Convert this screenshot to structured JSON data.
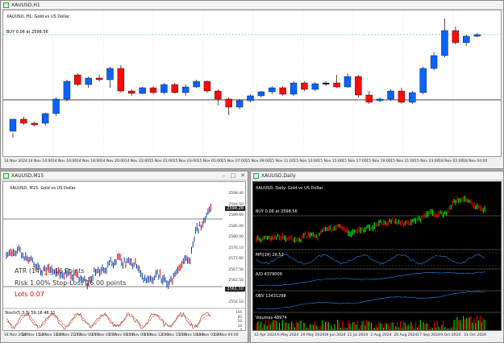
{
  "window_h1": {
    "title": "XAUUSD,H1",
    "chart_label": "XAUUSD, H1: Gold vs US Dollar",
    "order_label": "BUY 0.06 at 2598.56",
    "time_axis": [
      "14 Nov 2024",
      "14 Nov 14:00",
      "14 Nov 16:00",
      "14 Nov 18:00",
      "14 Nov 20:00",
      "14 Nov 22:00",
      "15 Nov 01:00",
      "15 Nov 03:00",
      "15 Nov 05:00",
      "15 Nov 07:00",
      "15 Nov 09:00",
      "15 Nov 11:00",
      "15 Nov 13:00",
      "15 Nov 15:00",
      "15 Nov 17:00",
      "15 Nov 19:00",
      "15 Nov 21:00",
      "15 Nov 23:00",
      "18 Nov 02:00",
      "18 Nov 04:00"
    ],
    "colors": {
      "bull": "#0b63ff",
      "bear": "#ff0a0a",
      "doji": "#000000",
      "background": "#ffffff",
      "grid": "#dcdcdc"
    }
  },
  "window_m15": {
    "title": "XAUUSD,M15",
    "chart_label": "XAUUSD, M15: Gold vs US Dollar",
    "price_labels": [
      "2598.40",
      "2594.50",
      "2589.60",
      "2585.00",
      "2580.00",
      "2576.10",
      "2571.60",
      "2567.50",
      "2562.50",
      "2558.60",
      "2554.10"
    ],
    "price_box": "2594.28",
    "price_box2": "2561.10",
    "overlay_line1": "ATR (14)  _ _ 16 Points",
    "overlay_line2": "Risk  1.00%   Stop-Loss   16.00 points",
    "overlay_line3": "Lots   0.07",
    "stoch_label": "Stoch(5,3,3) 59.16 48.31",
    "stoch_ticks": [
      "100",
      "80",
      "50",
      "20",
      "0"
    ],
    "time_axis": [
      "14 Nov 2024",
      "14 Nov 15:30",
      "14 Nov 18:30",
      "14 Nov 21:30",
      "15 Nov 00:30",
      "15 Nov 03:30",
      "15 Nov 06:30",
      "15 Nov 09:30",
      "15 Nov 12:30",
      "15 Nov 15:30",
      "15 Nov 18:30",
      "18 Nov 01:30",
      "18 Nov 04:00"
    ]
  },
  "window_daily": {
    "title": "XAUUSD,Daily",
    "chart_label": "XAUUSD, Daily: Gold vs US Dollar",
    "order_label": "BUY 0.06 at 2598.56",
    "mfi_label": "MFI(14) 26.52",
    "ad_label": "A/D 4379009",
    "obv_label": "OBV 13431298",
    "volumes_label": "Volumes 48974",
    "time_axis": [
      "12 Apr 2024",
      "6 May 2024",
      "29 May 2024",
      "19 Jun 2024",
      "11 Jul 2024",
      "2 Aug 2024",
      "26 Aug 2024",
      "17 Sep 2024",
      "9 Oct 2024",
      "31 Oct 2024"
    ],
    "colors": {
      "bull": "#00ff00",
      "bear": "#ff0000",
      "background": "#000000",
      "indicator": "#1e90ff",
      "grid": "#2a2a2a"
    }
  }
}
